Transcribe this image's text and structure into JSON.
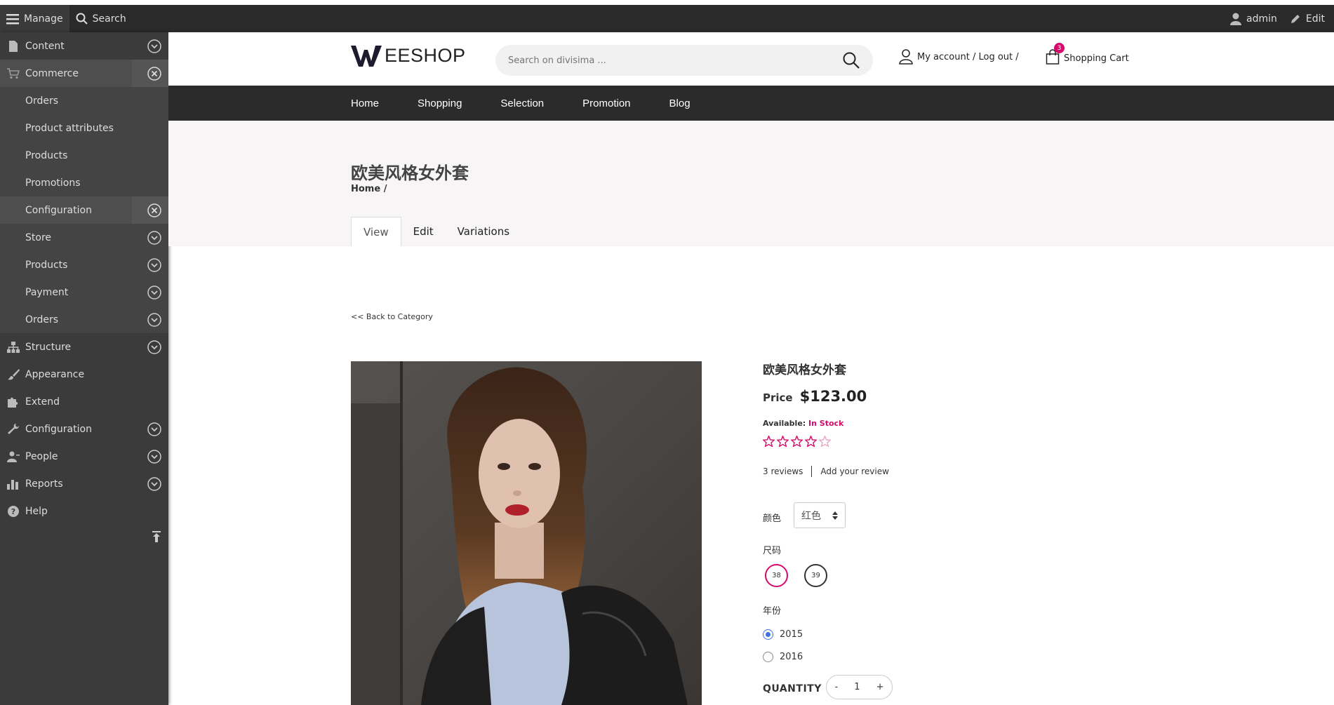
{
  "toolbar": {
    "manage_label": "Manage",
    "search_label": "Search",
    "user_label": "admin",
    "edit_label": "Edit"
  },
  "sidebar": {
    "items": [
      {
        "label": "Content",
        "icon": "file-icon",
        "toggle": "expand"
      },
      {
        "label": "Commerce",
        "icon": "cart-icon",
        "toggle": "collapse",
        "active": true
      },
      {
        "label": "Orders",
        "sub": true
      },
      {
        "label": "Product attributes",
        "sub": true
      },
      {
        "label": "Products",
        "sub": true
      },
      {
        "label": "Promotions",
        "sub": true
      },
      {
        "label": "Configuration",
        "sub": true,
        "toggle": "collapse",
        "active": true
      },
      {
        "label": "Store",
        "sub": true,
        "toggle": "expand"
      },
      {
        "label": "Products",
        "sub": true,
        "toggle": "expand"
      },
      {
        "label": "Payment",
        "sub": true,
        "toggle": "expand"
      },
      {
        "label": "Orders",
        "sub": true,
        "toggle": "expand"
      },
      {
        "label": "Structure",
        "icon": "sitemap-icon",
        "toggle": "expand"
      },
      {
        "label": "Appearance",
        "icon": "paintbrush-icon"
      },
      {
        "label": "Extend",
        "icon": "puzzle-icon"
      },
      {
        "label": "Configuration",
        "icon": "wrench-icon",
        "toggle": "expand"
      },
      {
        "label": "People",
        "icon": "person-icon",
        "toggle": "expand"
      },
      {
        "label": "Reports",
        "icon": "bar-chart-icon",
        "toggle": "expand"
      },
      {
        "label": "Help",
        "icon": "help-icon"
      }
    ]
  },
  "header": {
    "logo_text": "EESHOP",
    "search_placeholder": "Search on divisima ...",
    "account_label": "My account / Log out /",
    "cart_label": "Shopping Cart",
    "cart_count": "3"
  },
  "nav": {
    "items": [
      "Home",
      "Shopping",
      "Selection",
      "Promotion",
      "Blog"
    ]
  },
  "page": {
    "title": "欧美风格女外套",
    "breadcrumb": "Home /",
    "tabs": [
      "View",
      "Edit",
      "Variations"
    ],
    "back_link": "<< Back to Category"
  },
  "product": {
    "name": "欧美风格女外套",
    "price_label": "Price",
    "price": "$123.00",
    "available_label": "Available:",
    "stock_status": "In Stock",
    "rating": 4,
    "rating_max": 5,
    "reviews_count": "3 reviews",
    "add_review": "Add your review",
    "color_label": "颜色",
    "color_value": "红色",
    "size_label": "尺码",
    "sizes": [
      "38",
      "39"
    ],
    "selected_size": "38",
    "year_label": "年份",
    "years": [
      "2015",
      "2016"
    ],
    "selected_year": "2015",
    "quantity_label": "QUANTITY",
    "quantity": "1",
    "qty_minus": "-",
    "qty_plus": "+"
  },
  "colors": {
    "accent": "#d60a6a",
    "toolbar": "#2a2a2a",
    "sidebar": "#3b3b3b",
    "nav": "#2b2b2b"
  }
}
